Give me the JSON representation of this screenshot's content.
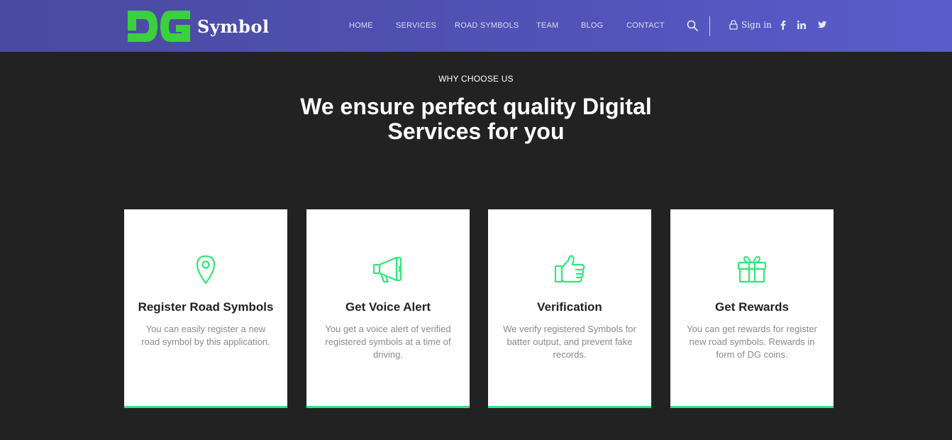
{
  "header": {
    "logo_mark": "DG",
    "logo_text": "Symbol",
    "nav": [
      {
        "label": "HOME"
      },
      {
        "label": "SERVICES"
      },
      {
        "label": "ROAD SYMBOLS"
      },
      {
        "label": "TEAM"
      },
      {
        "label": "BLOG"
      },
      {
        "label": "CONTACT"
      }
    ],
    "search_icon": "search-icon",
    "signin_label": "Sign in",
    "social_icons": [
      "facebook-icon",
      "linkedin-icon",
      "twitter-icon"
    ]
  },
  "section": {
    "kicker": "WHY CHOOSE US",
    "headline_line1": "We ensure perfect quality Digital",
    "headline_line2": "Services for you"
  },
  "cards": [
    {
      "icon": "map-pin-icon",
      "title": "Register Road Symbols",
      "desc": "You can easily register a new road symbol by this application."
    },
    {
      "icon": "megaphone-icon",
      "title": "Get Voice Alert",
      "desc": "You get a voice alert of verified registered symbols at a time of driving."
    },
    {
      "icon": "thumbs-up-icon",
      "title": "Verification",
      "desc": "We verify registered Symbols for batter output, and prevent fake records."
    },
    {
      "icon": "gift-icon",
      "title": "Get Rewards",
      "desc": "You can get rewards for register new road symbols. Rewards in form of DG coins."
    }
  ],
  "colors": {
    "accent_green": "#2ee87a",
    "logo_green": "#3ad13a",
    "header_purple": "#5352b8",
    "background": "#222222"
  }
}
